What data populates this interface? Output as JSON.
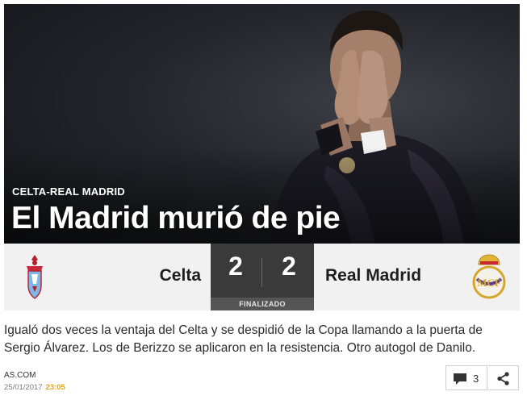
{
  "article": {
    "kicker": "CELTA-REAL MADRID",
    "headline": "El Madrid murió de pie",
    "summary": "Igualó dos veces la ventaja del Celta y se despidió de la Copa llamando a la puerta de Sergio Álvarez. Los de Berizzo se aplicaron en la resistencia. Otro autogol de Danilo."
  },
  "match": {
    "home_team": "Celta",
    "away_team": "Real Madrid",
    "home_score": "2",
    "away_score": "2",
    "status": "FINALIZADO"
  },
  "footer": {
    "source": "AS.COM",
    "date": "25/01/2017",
    "time": "23:05",
    "comments_count": "3"
  },
  "icons": {
    "comments": "speech-bubble-icon",
    "share": "share-icon",
    "home_crest": "celta-crest-icon",
    "away_crest": "real-madrid-crest-icon"
  },
  "colors": {
    "score_box": "#3a3a3a",
    "status_bar": "#555555",
    "time_accent": "#e6a21e",
    "scoreboard_bg": "#f1f1f1"
  }
}
